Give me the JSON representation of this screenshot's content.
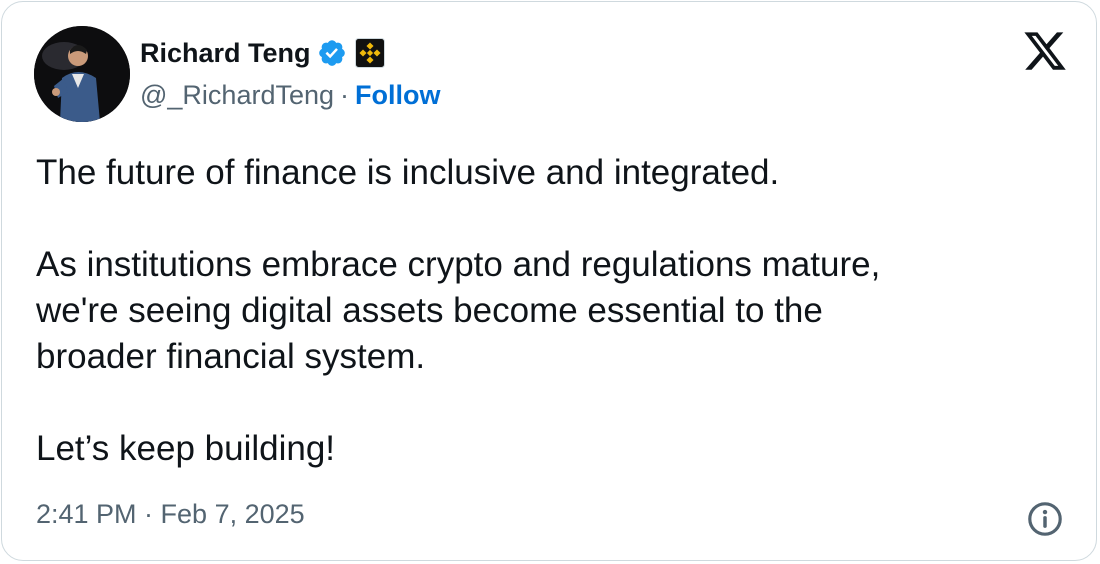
{
  "author": {
    "name": "Richard Teng",
    "handle": "@_RichardTeng",
    "separator": "·",
    "follow_label": "Follow",
    "verified_icon": "verified-badge-icon",
    "affiliation_icon": "binance-affiliate-icon"
  },
  "tweet": {
    "text": "The future of finance is inclusive and integrated.\n\nAs institutions embrace crypto and regulations mature,\nwe're seeing digital assets become essential to the\nbroader financial system.\n\nLet’s keep building!",
    "timestamp": "2:41 PM · Feb 7, 2025"
  },
  "icons": {
    "platform": "x-logo-icon",
    "info": "info-icon"
  },
  "colors": {
    "text": "#0f1419",
    "secondary": "#536471",
    "follow": "#006fd6",
    "verified": "#1d9bf0",
    "border": "#cfd9de",
    "binance": "#f0b90b"
  }
}
